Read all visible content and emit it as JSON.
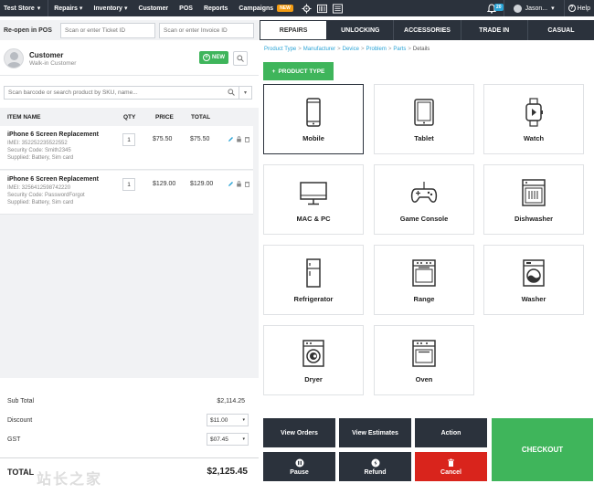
{
  "topnav": {
    "store": "Test Store",
    "items": [
      {
        "label": "Repairs",
        "dropdown": true
      },
      {
        "label": "Inventory",
        "dropdown": true
      },
      {
        "label": "Customer",
        "dropdown": false
      },
      {
        "label": "POS",
        "dropdown": false
      },
      {
        "label": "Reports",
        "dropdown": false
      },
      {
        "label": "Campaigns",
        "dropdown": false
      }
    ],
    "new_badge": "NEW",
    "notification_count": "20",
    "user": "Jason...",
    "help": "Help"
  },
  "reopen": {
    "label": "Re-open in POS",
    "ticket_placeholder": "Scan or enter Ticket ID",
    "invoice_placeholder": "Scan or enter Invoice ID"
  },
  "tabs": [
    "REPAIRS",
    "UNLOCKING",
    "ACCESSORIES",
    "TRADE IN",
    "CASUAL"
  ],
  "customer": {
    "name": "Customer",
    "sub": "Walk-in Customer",
    "new_label": "NEW"
  },
  "scan": {
    "placeholder": "Scan barcode or search product by SKU, name..."
  },
  "table": {
    "headers": [
      "ITEM NAME",
      "QTY",
      "PRICE",
      "TOTAL"
    ],
    "rows": [
      {
        "name": "iPhone 6 Screen Replacement",
        "imei": "IMEI: 352252235522552",
        "security": "Security Code: Smith2345",
        "supplied": "Supplied: Battery, Sim card",
        "qty": "1",
        "price": "$75.50",
        "total": "$75.50"
      },
      {
        "name": "iPhone 6 Screen Replacement",
        "imei": "IMEI: 3256412598742220",
        "security": "Security Code: PasswordForgot",
        "supplied": "Supplied: Battery, Sim card",
        "qty": "1",
        "price": "$129.00",
        "total": "$129.00"
      }
    ]
  },
  "totals": {
    "subtotal_label": "Sub Total",
    "subtotal": "$2,114.25",
    "discount_label": "Discount",
    "discount": "$11.00",
    "gst_label": "GST",
    "gst": "$07.45",
    "total_label": "TOTAL",
    "total": "$2,125.45"
  },
  "breadcrumb": [
    "Product Type",
    "Manufacturer",
    "Device",
    "Problem",
    "Parts",
    "Details"
  ],
  "product_type_btn": "PRODUCT TYPE",
  "products": [
    {
      "label": "Mobile",
      "icon": "mobile-icon"
    },
    {
      "label": "Tablet",
      "icon": "tablet-icon"
    },
    {
      "label": "Watch",
      "icon": "watch-icon"
    },
    {
      "label": "MAC & PC",
      "icon": "monitor-icon"
    },
    {
      "label": "Game Console",
      "icon": "gamepad-icon"
    },
    {
      "label": "Dishwasher",
      "icon": "dishwasher-icon"
    },
    {
      "label": "Refrigerator",
      "icon": "refrigerator-icon"
    },
    {
      "label": "Range",
      "icon": "range-icon"
    },
    {
      "label": "Washer",
      "icon": "washer-icon"
    },
    {
      "label": "Dryer",
      "icon": "dryer-icon"
    },
    {
      "label": "Oven",
      "icon": "oven-icon"
    }
  ],
  "actions": {
    "view_orders": "View Orders",
    "view_estimates": "View Estimates",
    "action": "Action",
    "pause": "Pause",
    "refund": "Refund",
    "cancel": "Cancel",
    "checkout": "CHECKOUT"
  },
  "watermark": "站长之家",
  "colors": {
    "nav": "#2b323c",
    "accent_green": "#3fb55b",
    "cancel_red": "#d9241c",
    "link_blue": "#29a3d6"
  }
}
